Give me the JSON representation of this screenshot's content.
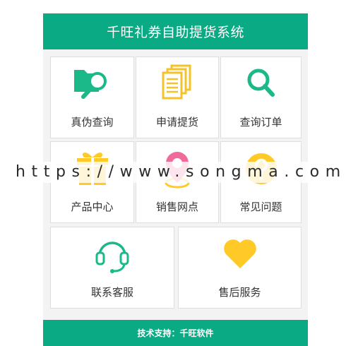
{
  "header": {
    "title": "千旺礼券自助提货系统"
  },
  "tiles": [
    {
      "label": "真伪查询",
      "icon": "folder-search-icon"
    },
    {
      "label": "申请提货",
      "icon": "documents-icon"
    },
    {
      "label": "查询订单",
      "icon": "magnifier-icon"
    },
    {
      "label": "产品中心",
      "icon": "gift-icon"
    },
    {
      "label": "销售网点",
      "icon": "location-pin-icon"
    },
    {
      "label": "常见问题",
      "icon": "question-icon"
    },
    {
      "label": "联系客服",
      "icon": "headset-icon"
    },
    {
      "label": "售后服务",
      "icon": "heart-icon"
    }
  ],
  "footer": {
    "text": "技术支持：千旺软件"
  },
  "watermark": {
    "text": "https://www.songma.com"
  },
  "colors": {
    "brand": "#0aab84",
    "yellow": "#ffc928",
    "pink": "#f06a9b",
    "green_icon": "#1bb98a"
  }
}
